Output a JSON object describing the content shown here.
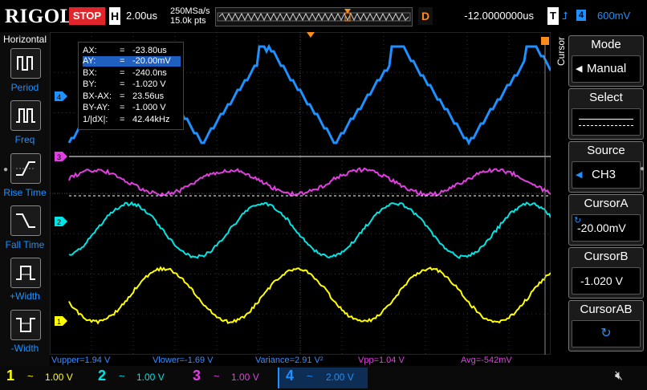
{
  "topbar": {
    "logo": "RIGOL",
    "run_state": "STOP",
    "h_label": "H",
    "timebase": "2.00us",
    "sample_rate": "250MSa/s",
    "points": "15.0k pts",
    "delay_label": "D",
    "delay": "-12.0000000us",
    "trigger_label": "T",
    "trigger_source": "4",
    "trigger_level": "600mV"
  },
  "left_menu": {
    "title": "Horizontal",
    "items": [
      {
        "label": "Period",
        "icon": "period-icon"
      },
      {
        "label": "Freq",
        "icon": "freq-icon"
      },
      {
        "label": "Rise Time",
        "icon": "rise-time-icon"
      },
      {
        "label": "Fall Time",
        "icon": "fall-time-icon"
      },
      {
        "label": "+Width",
        "icon": "positive-width-icon"
      },
      {
        "label": "-Width",
        "icon": "negative-width-icon"
      }
    ]
  },
  "cursor_info": {
    "rows": [
      {
        "k": "AX:",
        "v": "-23.80us"
      },
      {
        "k": "AY:",
        "v": "-20.00mV"
      },
      {
        "k": "BX:",
        "v": "-240.0ns"
      },
      {
        "k": "BY:",
        "v": "-1.020 V"
      },
      {
        "k": "BX-AX:",
        "v": "23.56us"
      },
      {
        "k": "BY-AY:",
        "v": "-1.000 V"
      },
      {
        "k": "1/|dX|:",
        "v": "42.44kHz"
      }
    ],
    "eq": "="
  },
  "right_menu": {
    "vertical_title": "Cursor",
    "mode_title": "Mode",
    "mode_value": "Manual",
    "select_title": "Select",
    "source_title": "Source",
    "source_value": "CH3",
    "cursor_a_title": "CursorA",
    "cursor_a_value": "-20.00mV",
    "cursor_b_title": "CursorB",
    "cursor_b_value": "-1.020 V",
    "cursor_ab_title": "CursorAB"
  },
  "measurements": [
    {
      "text": "Vupper=1.94 V",
      "color": "#3b8cff"
    },
    {
      "text": "Vlower=-1.69 V",
      "color": "#3b8cff"
    },
    {
      "text": "Variance=2.91 V²",
      "color": "#3b8cff"
    },
    {
      "text": "Vpp=1.04 V",
      "color": "#e040e0"
    },
    {
      "text": "Avg=-542mV",
      "color": "#e040e0"
    }
  ],
  "channels": [
    {
      "num": "1",
      "coupling": "~",
      "scale": "1.00 V",
      "color": "#ffff00"
    },
    {
      "num": "2",
      "coupling": "~",
      "scale": "1.00 V",
      "color": "#00e5e5"
    },
    {
      "num": "3",
      "coupling": "~",
      "scale": "1.00 V",
      "color": "#e040e0"
    },
    {
      "num": "4",
      "coupling": "~",
      "scale": "2.00 V",
      "color": "#1e90ff"
    }
  ],
  "markers": {
    "ch1": "1",
    "ch2": "2",
    "ch3": "3",
    "ch4": "4"
  },
  "colors": {
    "ch1": "#ffff00",
    "ch2": "#00e5e5",
    "ch3": "#e040e0",
    "ch4": "#1e90ff",
    "trigger": "#ff8c1a"
  }
}
